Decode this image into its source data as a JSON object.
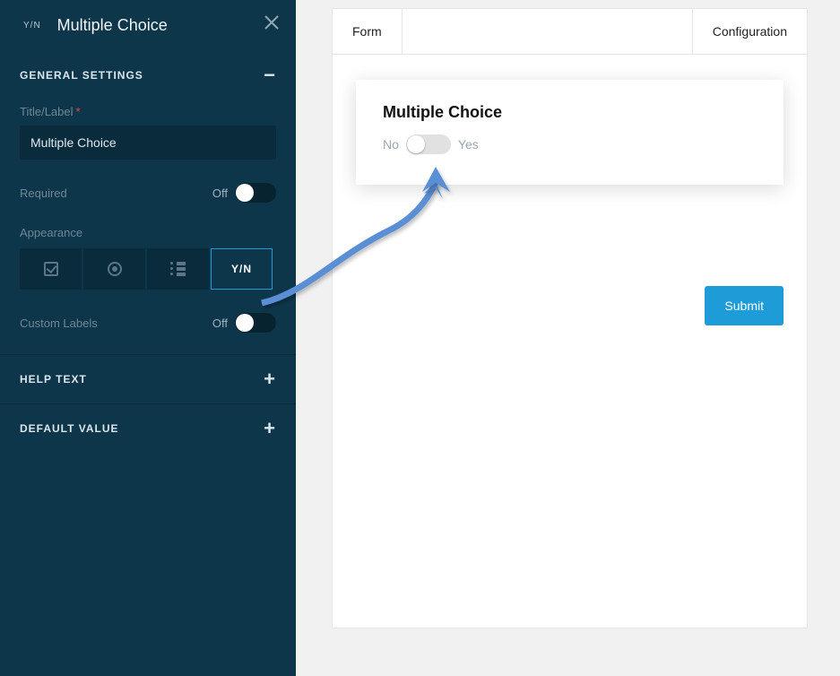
{
  "sidebar": {
    "badge": "Y/N",
    "title": "Multiple Choice",
    "sections": {
      "general": {
        "header": "GENERAL SETTINGS",
        "title_label": "Title/Label",
        "title_value": "Multiple Choice",
        "required_label": "Required",
        "required_state": "Off",
        "appearance_label": "Appearance",
        "appearance_options": {
          "yn": "Y/N"
        },
        "custom_labels_label": "Custom Labels",
        "custom_labels_state": "Off"
      },
      "help": {
        "header": "HELP TEXT"
      },
      "default": {
        "header": "DEFAULT VALUE"
      }
    }
  },
  "tabs": {
    "form": "Form",
    "config": "Configuration"
  },
  "card": {
    "title": "Multiple Choice",
    "no": "No",
    "yes": "Yes"
  },
  "submit": "Submit"
}
